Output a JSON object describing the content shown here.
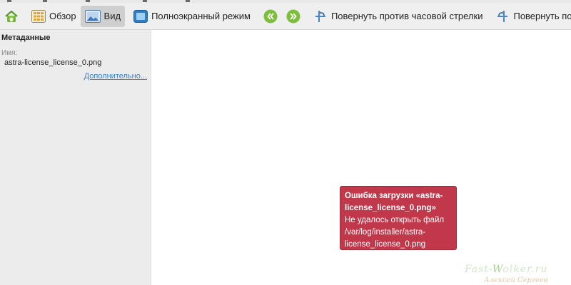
{
  "toolbar": {
    "home_icon": "home-icon",
    "overview_label": "Обзор",
    "view_label": "Вид",
    "fullscreen_label": "Полноэкранный режим",
    "rotate_ccw_label": "Повернуть против часовой стрелки",
    "rotate_cw_label": "Повернуть по часо"
  },
  "sidebar": {
    "title": "Метаданные",
    "name_label": "Имя:",
    "name_value": "astra-license_license_0.png",
    "more_link": "Дополнительно..."
  },
  "error": {
    "title": "Ошибка загрузки «astra-license_license_0.png»",
    "message": "Не удалось открыть файл /var/log/installer/astra-license_license_0.png"
  },
  "watermark": {
    "site_prefix": "Fast-",
    "site_accent": "W",
    "site_suffix": "olker.ru",
    "signature": "Алексей Сергеев"
  },
  "colors": {
    "toolbar_bg": "#efefef",
    "sidebar_bg": "#ececec",
    "error_bg": "#c0384a",
    "link": "#3a7fc7",
    "nav_green": "#7cbf3a"
  }
}
